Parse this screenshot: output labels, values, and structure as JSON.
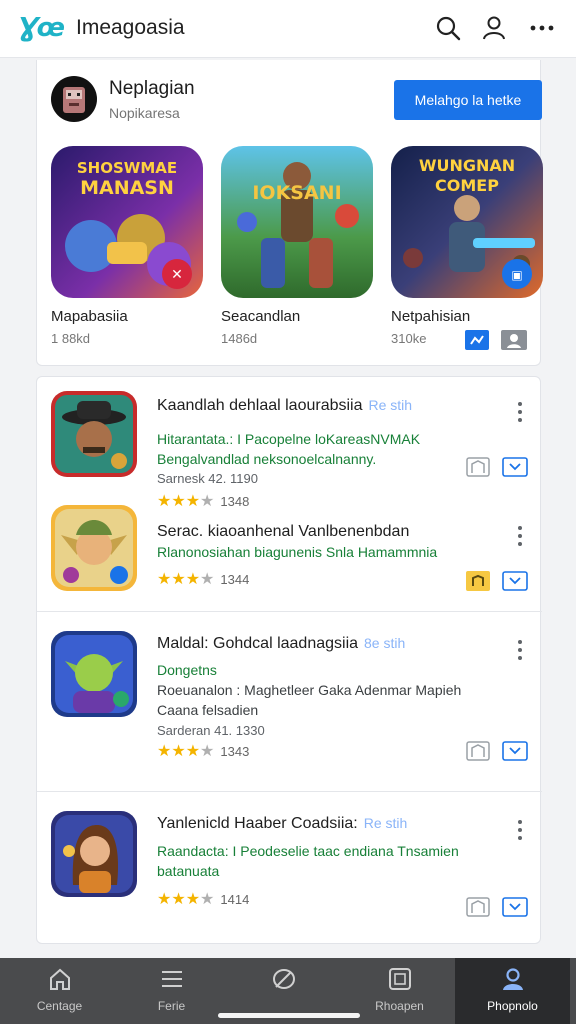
{
  "header": {
    "logo": "Ɣœ",
    "title": "Imeagoasia",
    "icons": [
      "search-icon",
      "account-icon",
      "more-vert-icon"
    ]
  },
  "developer": {
    "name": "Neplagian",
    "subtitle": "Nopikaresa",
    "button_label": "Melahgo la hetke",
    "featured": [
      {
        "name": "Mapabasiia",
        "size": "1 88kd",
        "art_text": [
          "SHOSWMAE",
          "MANASN"
        ]
      },
      {
        "name": "Seacandlan",
        "size": "1486d",
        "art_text": [
          "IOKSANI"
        ]
      },
      {
        "name": "Netpahisian",
        "size": "310ke",
        "art_text": [
          "WUNGNAN",
          "COMEP"
        ]
      }
    ]
  },
  "apps": [
    {
      "title": "Kaandlah dehlaal laourabsiia",
      "tag": "Re stih",
      "line1": "Hitarantata.: I Pacopelne loKareasNVMAK",
      "line2": "Bengalvandlad neksonoelcalnanny.",
      "meta": "Sarnesk 42. 1190",
      "rating": 3,
      "rating_count": "1348",
      "icon": "cowboy-icon",
      "action_b": "download-icon"
    },
    {
      "title": "Serac. kiaoanhenal Vanlbenenbdan",
      "tag": "",
      "line1": "Rlanonosiahan biagunenis Snla Hamammnia",
      "line2": "",
      "meta": "",
      "rating": 3,
      "rating_count": "1344",
      "icon": "elf-icon",
      "action_b": "download-icon"
    },
    {
      "title": "Maldal: Gohdcal laadnagsiia",
      "tag": "8e stih",
      "line1": "Dongetns",
      "line2": "Roeuanalon : Maghetleer Gaka Adenmar Mapieh",
      "line3": "Caana felsadien",
      "meta": "Sarderan 41. 1330",
      "rating": 3,
      "rating_count": "1343",
      "icon": "goblin-icon",
      "action_b": "download-icon"
    },
    {
      "title": "Yanlenicld Haaber Coadsiia:",
      "tag": "Re stih",
      "line1": "Raandacta: I Peodeselie taac endiana Tnsamien",
      "line2": "batanuata",
      "meta": "",
      "rating": 3,
      "rating_count": "1414",
      "icon": "heroine-icon",
      "action_b": "download-icon"
    }
  ],
  "nav": [
    {
      "label": "Centage",
      "icon": "home-icon"
    },
    {
      "label": "Ferie",
      "icon": "menu-icon"
    },
    {
      "label": "",
      "icon": "leaf-icon"
    },
    {
      "label": "Rhoapen",
      "icon": "apps-box-icon"
    },
    {
      "label": "Phopnolo",
      "icon": "profile-icon"
    }
  ],
  "colors": {
    "accent": "#1a73e8",
    "green_text": "#188038",
    "star": "#f4b400",
    "nav_bg": "#4a4b4d"
  }
}
